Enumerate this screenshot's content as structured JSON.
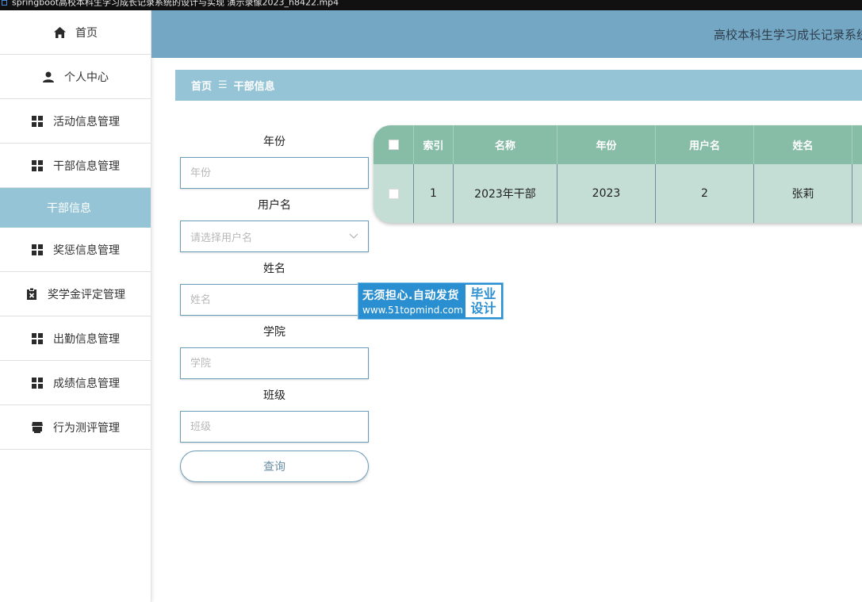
{
  "window": {
    "title": "springboot高校本科生学习成长记录系统的设计与实现 演示录像2023_h8422.mp4"
  },
  "sidebar": {
    "items": [
      {
        "label": "首页",
        "icon": "home-icon"
      },
      {
        "label": "个人中心",
        "icon": "user-icon"
      },
      {
        "label": "活动信息管理",
        "icon": "grid-icon"
      },
      {
        "label": "干部信息管理",
        "icon": "grid-icon"
      },
      {
        "label": "干部信息",
        "icon": "",
        "active": true
      },
      {
        "label": "奖惩信息管理",
        "icon": "grid-icon"
      },
      {
        "label": "奖学金评定管理",
        "icon": "clipboard-x-icon"
      },
      {
        "label": "出勤信息管理",
        "icon": "grid-icon"
      },
      {
        "label": "成绩信息管理",
        "icon": "grid-icon"
      },
      {
        "label": "行为测评管理",
        "icon": "shop-icon"
      }
    ],
    "active_color": "#95c4d6"
  },
  "header": {
    "system_title": "高校本科生学习成长记录系统",
    "bg_color": "#74a7c4"
  },
  "breadcrumb": {
    "home": "首页",
    "separator": "☰",
    "current": "干部信息"
  },
  "search": {
    "fields": [
      {
        "label": "年份",
        "placeholder": "年份"
      },
      {
        "label": "用户名",
        "placeholder": "请选择用户名"
      },
      {
        "label": "姓名",
        "placeholder": "姓名"
      },
      {
        "label": "学院",
        "placeholder": "学院"
      },
      {
        "label": "班级",
        "placeholder": "班级"
      }
    ],
    "query_button": "查询"
  },
  "table": {
    "columns": [
      "索引",
      "名称",
      "年份",
      "用户名",
      "姓名"
    ],
    "rows": [
      {
        "index": "1",
        "name": "2023年干部",
        "year": "2023",
        "username": "2",
        "realname": "张莉"
      }
    ],
    "header_color": "#87bca7",
    "row_color": "#c4ddd5"
  },
  "watermark": {
    "line1": "无须担心.自动发货",
    "line2": "www.51topmind.com",
    "badge_line1": "毕业",
    "badge_line2": "设计"
  }
}
